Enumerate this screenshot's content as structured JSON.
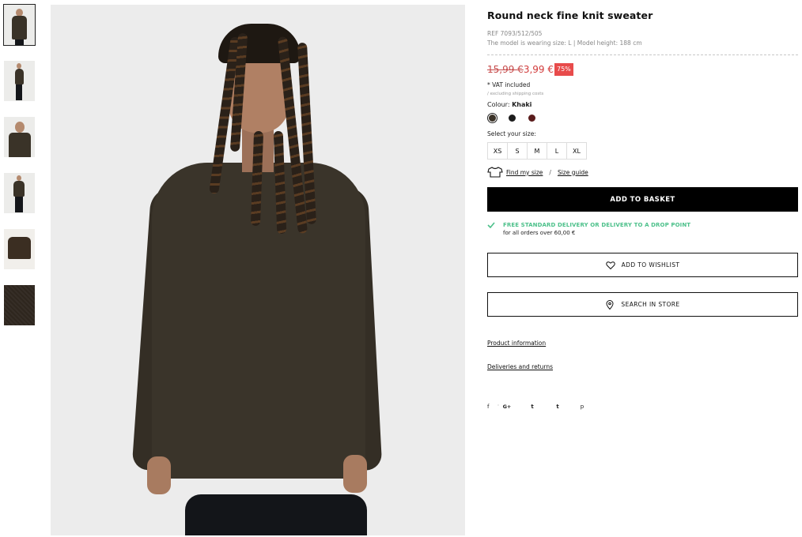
{
  "product": {
    "title": "Round neck fine knit sweater",
    "ref": "REF 7093/512/505",
    "model_info": "The model is wearing size: L | Model height: 188 cm",
    "old_price": "15,99 €",
    "new_price": "3,99 €",
    "discount": "75%",
    "vat": "* VAT included",
    "shipping_note": "/ excluding shipping costs",
    "colour_label": "Colour: ",
    "colour_value": "Khaki",
    "colours": [
      "#3b3328",
      "#1d1d1d",
      "#5a1c1c"
    ],
    "size_label": "Select your size:",
    "sizes": [
      "XS",
      "S",
      "M",
      "L",
      "XL"
    ],
    "find_size": "Find my size",
    "size_sep": "/",
    "size_guide": "Size guide",
    "add_to_basket": "ADD TO BASKET",
    "delivery_main": "FREE STANDARD DELIVERY OR DELIVERY TO A DROP POINT",
    "delivery_sub": "for all orders over 60,00 €",
    "add_to_wishlist": "ADD TO WISHLIST",
    "search_in_store": "SEARCH IN STORE",
    "product_information": "Product information",
    "deliveries_returns": "Deliveries and returns"
  },
  "social": {
    "facebook": "f",
    "googleplus": "G+",
    "twitter": "t",
    "tumblr": "t",
    "pinterest": "p"
  },
  "colors": {
    "accent_green": "#4cc08a",
    "discount_red": "#e84b4b",
    "price_red": "#d23b3b",
    "button_black": "#000000"
  }
}
